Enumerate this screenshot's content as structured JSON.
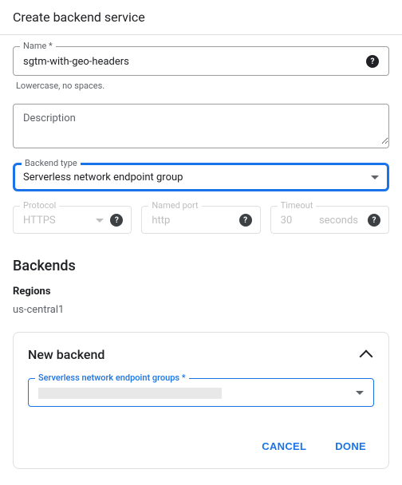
{
  "title": "Create backend service",
  "name_field": {
    "label": "Name",
    "required": "*",
    "value": "sgtm-with-geo-headers",
    "helper": "Lowercase, no spaces."
  },
  "description": {
    "placeholder": "Description"
  },
  "backend_type": {
    "label": "Backend type",
    "value": "Serverless network endpoint group"
  },
  "protocol": {
    "label": "Protocol",
    "value": "HTTPS"
  },
  "named_port": {
    "label": "Named port",
    "value": "http"
  },
  "timeout": {
    "label": "Timeout",
    "value": "30",
    "unit": "seconds"
  },
  "backends": {
    "heading": "Backends",
    "regions_label": "Regions",
    "region": "us-central1"
  },
  "new_backend": {
    "title": "New backend",
    "neg_label": "Serverless network endpoint groups",
    "required": "*",
    "actions": {
      "cancel": "CANCEL",
      "done": "DONE"
    }
  },
  "glyphs": {
    "help": "?"
  }
}
